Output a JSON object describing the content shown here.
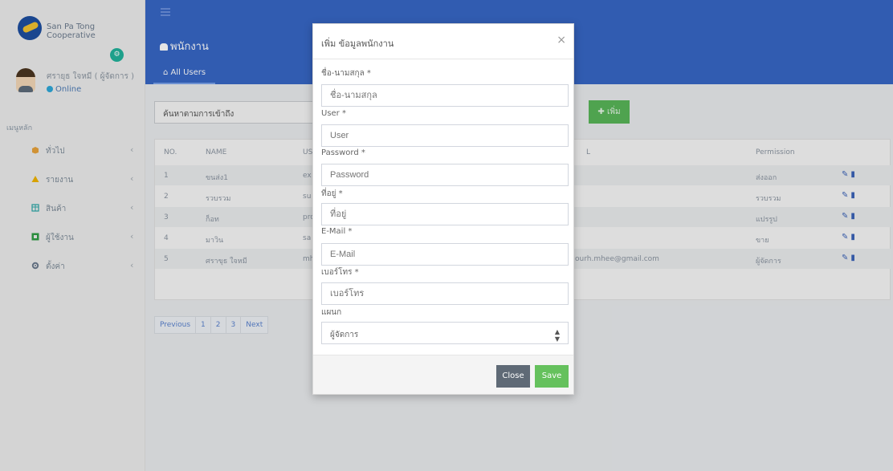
{
  "sidebar": {
    "brand_name": "San Pa Tong Cooperative",
    "user_name": "ศรายุธ ใจหมี ( ผู้จัดการ )",
    "user_status": "Online",
    "menu_title": "เมนูหลัก",
    "items": [
      {
        "label": "ทั่วไป",
        "icon": "cube-icon",
        "color": "#e8a33b"
      },
      {
        "label": "รายงาน",
        "icon": "warning-icon",
        "color": "#f0b400"
      },
      {
        "label": "สินค้า",
        "icon": "table-icon",
        "color": "#2aa8a8"
      },
      {
        "label": "ผู้ใช้งาน",
        "icon": "users-icon",
        "color": "#2f9e44"
      },
      {
        "label": "ตั้งค่า",
        "icon": "gear-icon",
        "color": "#6b7b8e"
      }
    ]
  },
  "header": {
    "page_title": "พนักงาน",
    "tab_label": "All Users"
  },
  "toolbar": {
    "search_placeholder": "ค้นหาตามการเข้าถึง",
    "add_button": "เพิ่ม"
  },
  "table": {
    "columns": [
      "NO.",
      "NAME",
      "US",
      "L",
      "Permission"
    ],
    "rows": [
      {
        "no": "1",
        "name": "ขนส่ง1",
        "user": "ex",
        "email": "",
        "permission": "ส่งออก"
      },
      {
        "no": "2",
        "name": "รวบรวม",
        "user": "su",
        "email": "",
        "permission": "รวบรวม"
      },
      {
        "no": "3",
        "name": "ก็อท",
        "user": "pro",
        "email": "",
        "permission": "แปรรูป"
      },
      {
        "no": "4",
        "name": "มาวิน",
        "user": "sa",
        "email": "",
        "permission": "ขาย"
      },
      {
        "no": "5",
        "name": "ศราขุธ ใจหมี",
        "user": "mh",
        "email": "ourh.mhee@gmail.com",
        "permission": "ผู้จัดการ"
      }
    ]
  },
  "pagination": [
    "Previous",
    "1",
    "2",
    "3",
    "Next"
  ],
  "modal": {
    "title": "เพิ่ม ข้อมูลพนักงาน",
    "close_x": "×",
    "fields": [
      {
        "label": "ชื่อ-นามสกุล *",
        "placeholder": "ชื่อ-นามสกุล"
      },
      {
        "label": "User *",
        "placeholder": "User"
      },
      {
        "label": "Password *",
        "placeholder": "Password"
      },
      {
        "label": "ที่อยู่ *",
        "placeholder": "ที่อยู่"
      },
      {
        "label": "E-Mail *",
        "placeholder": "E-Mail"
      },
      {
        "label": "เบอร์โทร *",
        "placeholder": "เบอร์โทร"
      }
    ],
    "department_label": "แผนก",
    "department_value": "ผู้จัดการ",
    "close_button": "Close",
    "save_button": "Save"
  }
}
